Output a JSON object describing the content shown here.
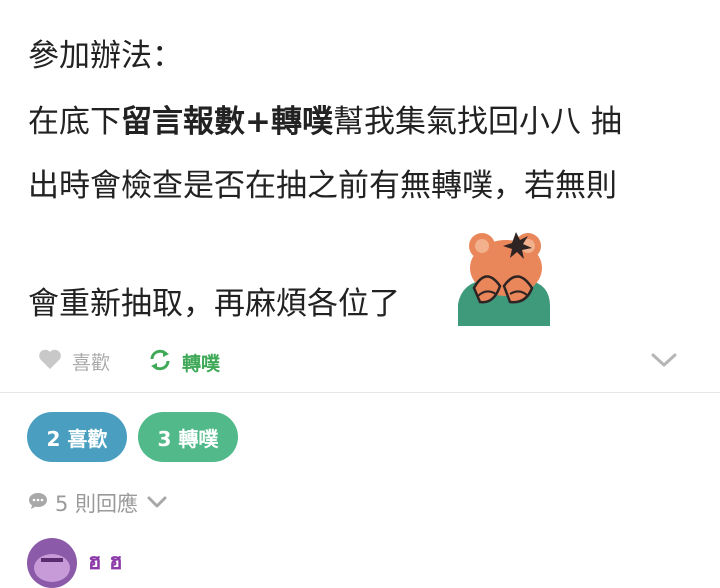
{
  "post": {
    "line1": "參加辦法：",
    "line2_prefix": "在底下",
    "line2_bold": "留言報數+轉噗",
    "line2_suffix": "幫我集氣找回小八 抽",
    "line3": "出時會檢查是否在抽之前有無轉噗，若無則",
    "line4": "會重新抽取，再麻煩各位了"
  },
  "actions": {
    "like_label": "喜歡",
    "replurk_label": "轉噗"
  },
  "stats": {
    "likes": "2 喜歡",
    "replurks": "3 轉噗"
  },
  "responses": {
    "label": "5 則回應"
  },
  "reply": {
    "name": "ฮ ฮ"
  },
  "colors": {
    "like_pill": "#4a9fc0",
    "replurk_pill": "#52b98a",
    "replurk_green": "#3fa958",
    "muted_gray": "#aaaaaa",
    "avatar_purple": "#8b5aa8"
  },
  "icons": [
    "heart-icon",
    "replurk-icon",
    "chevron-down-icon",
    "comment-icon",
    "sticker-image"
  ]
}
